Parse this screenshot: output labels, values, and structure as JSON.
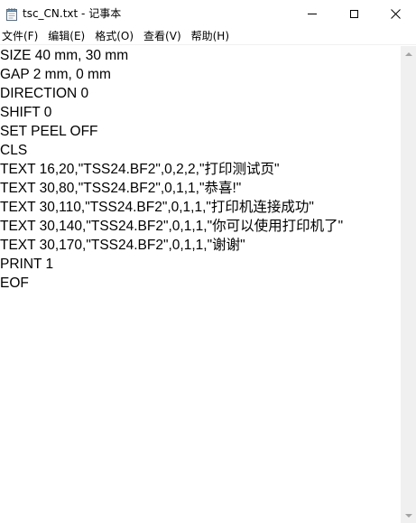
{
  "window": {
    "title": "tsc_CN.txt - 记事本",
    "icon": "notepad-icon"
  },
  "menu": [
    {
      "label": "文件(F)"
    },
    {
      "label": "编辑(E)"
    },
    {
      "label": "格式(O)"
    },
    {
      "label": "查看(V)"
    },
    {
      "label": "帮助(H)"
    }
  ],
  "editor": {
    "lines": [
      "SIZE 40 mm, 30 mm",
      "GAP 2 mm, 0 mm",
      "DIRECTION 0",
      "SHIFT 0",
      "SET PEEL OFF",
      "CLS",
      "TEXT 16,20,\"TSS24.BF2\",0,2,2,\"打印测试页\"",
      "TEXT 30,80,\"TSS24.BF2\",0,1,1,\"恭喜!\"",
      "TEXT 30,110,\"TSS24.BF2\",0,1,1,\"打印机连接成功\"",
      "TEXT 30,140,\"TSS24.BF2\",0,1,1,\"你可以使用打印机了\"",
      "TEXT 30,170,\"TSS24.BF2\",0,1,1,\"谢谢\"",
      "PRINT 1",
      "EOF"
    ]
  },
  "colors": {
    "background": "#ffffff",
    "scrollbar": "#f0f0f0",
    "text": "#000000"
  }
}
